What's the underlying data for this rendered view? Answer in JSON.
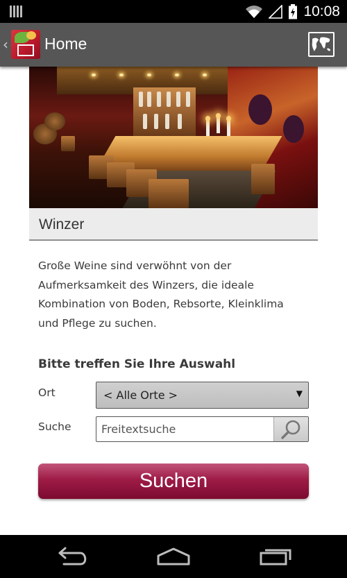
{
  "status_bar": {
    "time": "10:08",
    "icons": [
      "sim-icon",
      "wifi-icon",
      "signal-icon",
      "battery-charging-icon"
    ]
  },
  "action_bar": {
    "title": "Home",
    "logo_icon": "winery-app-logo-icon",
    "map_icon": "world-map-icon",
    "up_icon": "chevron-left-icon"
  },
  "hero": {
    "image": "wine-bar-interior-photo"
  },
  "section": {
    "title": "Winzer"
  },
  "description": {
    "lines": [
      "Große Weine sind verwöhnt von der",
      "Aufmerksamkeit des Winzers, die ideale",
      "Kombination von Boden, Rebsorte, Kleinklima",
      "und Pflege zu suchen."
    ]
  },
  "form": {
    "title": "Bitte treffen Sie Ihre Auswahl",
    "ort_label": "Ort",
    "ort_selected": "< Alle Orte >",
    "suche_label": "Suche",
    "search_placeholder": "Freitextsuche",
    "search_icon": "magnifier-icon",
    "submit_label": "Suchen"
  },
  "nav_bar": {
    "icons": [
      "back-icon",
      "home-icon",
      "recent-apps-icon"
    ]
  },
  "colors": {
    "action_bar": "#565656",
    "submit_button": "#9e1c46",
    "section_background": "#ececec"
  }
}
